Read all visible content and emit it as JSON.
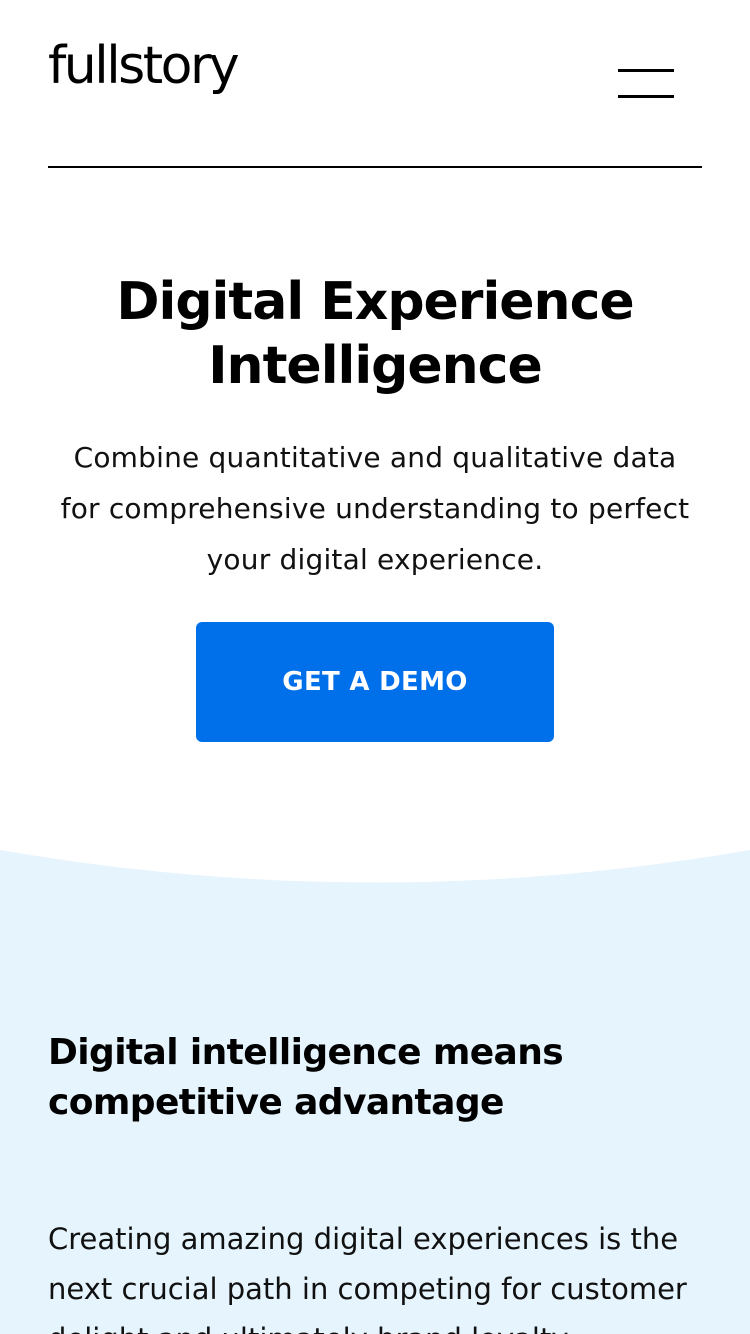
{
  "header": {
    "logo_text": "fullstory",
    "menu_icon": "hamburger-menu-icon"
  },
  "hero": {
    "title": "Digital Experience Intelligence",
    "subtitle": "Combine quantitative and qualitative data for comprehensive understanding to perfect your digital experience.",
    "cta_label": "GET A DEMO"
  },
  "section": {
    "heading": "Digital intelligence means competitive advantage",
    "body": "Creating amazing digital experiences is the next crucial path in competing for customer delight and ultimately brand loyalty."
  },
  "colors": {
    "accent": "#0070ea",
    "section_background": "#e5f4fd",
    "text": "#000000"
  }
}
